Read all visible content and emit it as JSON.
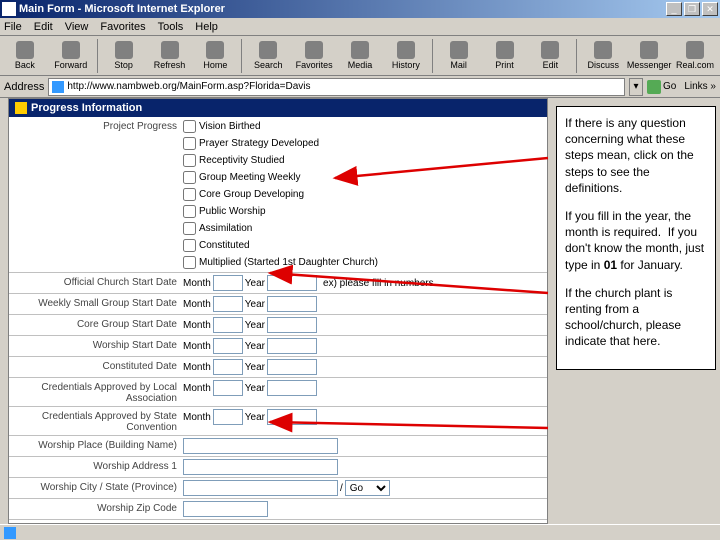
{
  "window": {
    "title": "Main Form - Microsoft Internet Explorer"
  },
  "menu": {
    "file": "File",
    "edit": "Edit",
    "view": "View",
    "favorites": "Favorites",
    "tools": "Tools",
    "help": "Help"
  },
  "toolbar": {
    "back": "Back",
    "forward": "Forward",
    "stop": "Stop",
    "refresh": "Refresh",
    "home": "Home",
    "search": "Search",
    "favorites": "Favorites",
    "media": "Media",
    "history": "History",
    "mail": "Mail",
    "print": "Print",
    "edit": "Edit",
    "discuss": "Discuss",
    "messenger": "Messenger",
    "realcom": "Real.com"
  },
  "address": {
    "label": "Address",
    "url": "http://www.nambweb.org/MainForm.asp?Florida=Davis",
    "go": "Go",
    "links": "Links »"
  },
  "section": {
    "title": "Progress Information"
  },
  "labels": {
    "progress": "Project Progress",
    "official": "Official Church Start Date",
    "weekly": "Weekly Small Group Start Date",
    "core": "Core Group Start Date",
    "worship": "Worship Start Date",
    "constituted": "Constituted Date",
    "credlocal": "Credentials Approved by Local Association",
    "credstate": "Credentials Approved by State Convention",
    "place": "Worship Place (Building Name)",
    "addr1": "Worship Address 1",
    "citystate": "Worship City / State (Province)",
    "zip": "Worship Zip Code",
    "month": "Month",
    "year": "Year",
    "example": "ex) please fill in numbers."
  },
  "checks": {
    "c1": "Vision Birthed",
    "c2": "Prayer Strategy Developed",
    "c3": "Receptivity Studied",
    "c4": "Group Meeting Weekly",
    "c5": "Core Group Developing",
    "c6": "Public Worship",
    "c7": "Assimilation",
    "c8": "Constituted",
    "c9": "Multiplied (Started 1st Daughter Church)"
  },
  "note": {
    "p1": "If there is any question concerning what these steps mean, click on the steps to see the definitions.",
    "p2": "If you fill in the year, the month is required.  If you don't know the month, just type in 01 for January.",
    "p3": "If the church plant is renting from a school/church, please indicate that here."
  },
  "bold": {
    "b01": "01"
  }
}
